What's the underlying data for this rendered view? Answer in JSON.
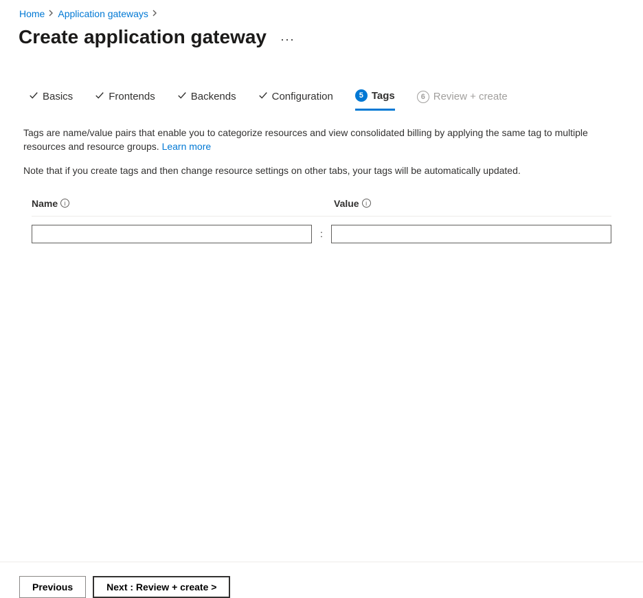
{
  "breadcrumb": {
    "home": "Home",
    "gateways": "Application gateways"
  },
  "page": {
    "title": "Create application gateway"
  },
  "tabs": {
    "basics": "Basics",
    "frontends": "Frontends",
    "backends": "Backends",
    "configuration": "Configuration",
    "tags_num": "5",
    "tags": "Tags",
    "review_num": "6",
    "review": "Review + create"
  },
  "content": {
    "desc_part1": "Tags are name/value pairs that enable you to categorize resources and view consolidated billing by applying the same tag to multiple resources and resource groups. ",
    "learn_more": "Learn more",
    "note": "Note that if you create tags and then change resource settings on other tabs, your tags will be automatically updated."
  },
  "table": {
    "name_header": "Name",
    "value_header": "Value",
    "name_value": "",
    "value_value": ""
  },
  "footer": {
    "previous": "Previous",
    "next": "Next : Review + create >"
  }
}
